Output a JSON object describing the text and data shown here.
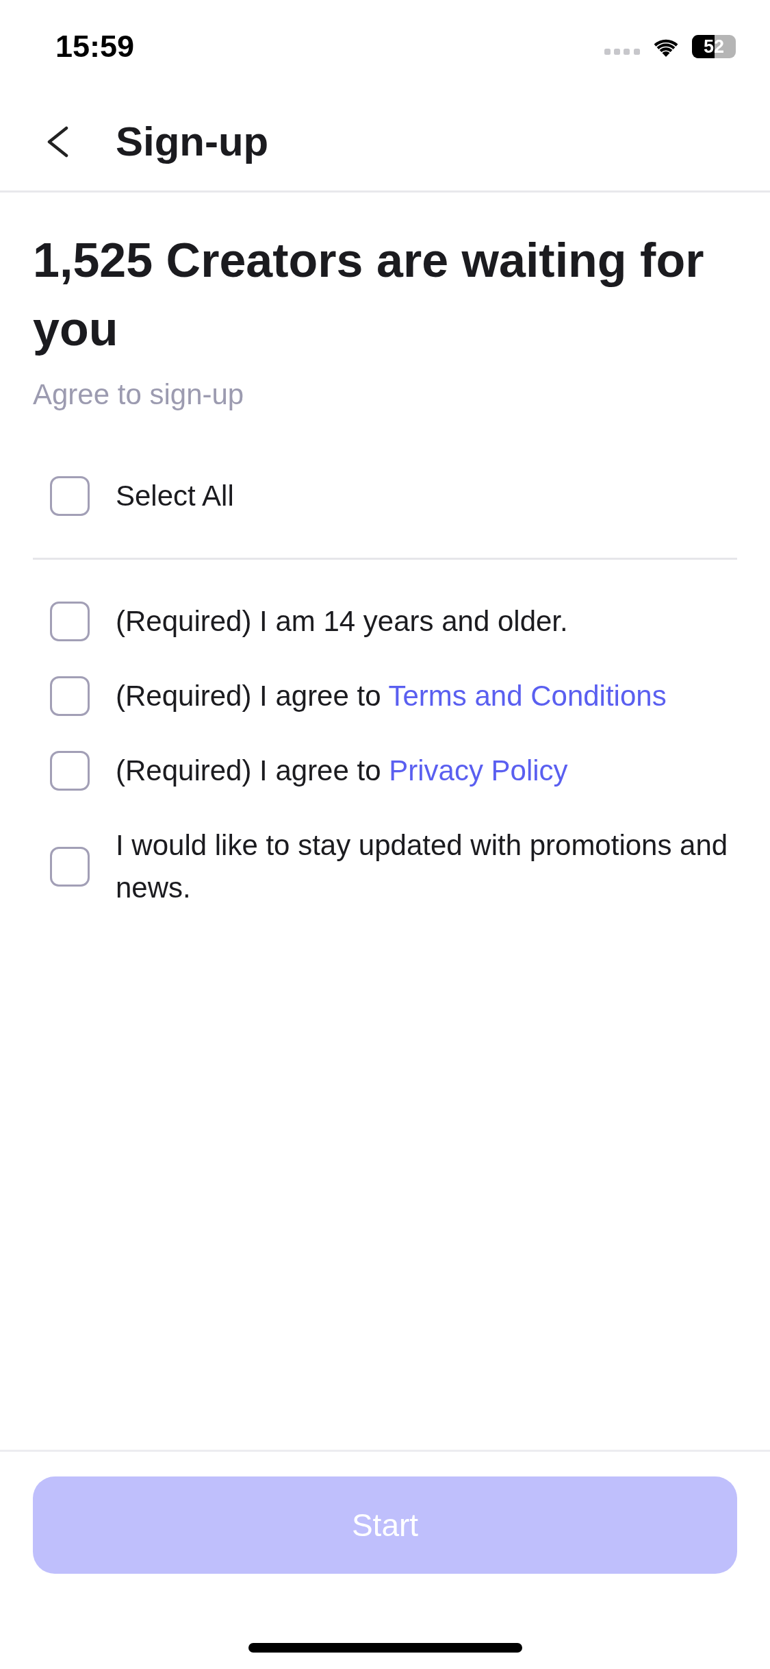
{
  "status_bar": {
    "time": "15:59",
    "battery": "52"
  },
  "header": {
    "title": "Sign-up"
  },
  "heading": {
    "title": "1,525 Creators are waiting for you",
    "subtitle": "Agree to sign-up"
  },
  "select_all": {
    "label": "Select All",
    "checked": false
  },
  "agreements": [
    {
      "text": "(Required) I am 14 years and older.",
      "checked": false
    },
    {
      "text": "(Required) I agree to",
      "link": "Terms and Conditions",
      "checked": false
    },
    {
      "text": "(Required) I agree to",
      "link": "Privacy Policy",
      "checked": false
    },
    {
      "text": "I would like to stay updated with promotions and news.",
      "checked": false
    }
  ],
  "start_button": {
    "label": "Start",
    "disabled": true
  }
}
